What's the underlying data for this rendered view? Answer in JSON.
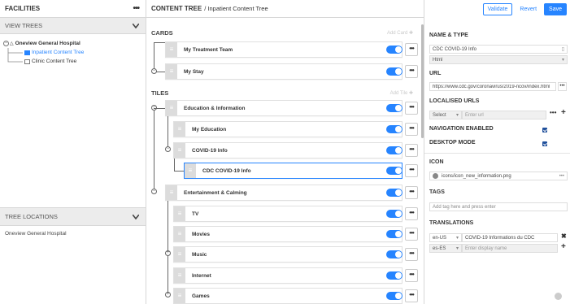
{
  "left": {
    "facilities_title": "FACILITIES",
    "view_trees": "VIEW TREES",
    "tree": [
      {
        "label": "Oneview General Hospital"
      },
      {
        "label": "Inpatient Content Tree"
      },
      {
        "label": "Clinic Content Tree"
      }
    ],
    "tree_locations": "TREE LOCATIONS",
    "locations": [
      "Oneview General Hospital"
    ]
  },
  "middle": {
    "title": "CONTENT TREE",
    "breadcrumb": "/ Inpatient Content Tree",
    "cards_label": "CARDS",
    "add_card": "Add Card",
    "cards": [
      "My Treatment Team",
      "My Stay"
    ],
    "tiles_label": "TILES",
    "add_tile": "Add Tile",
    "tiles": [
      "Education & Information",
      "My Education",
      "COVID-19 Info",
      "CDC COVID-19 Info",
      "Entertainment & Calming",
      "TV",
      "Movies",
      "Music",
      "Internet",
      "Games"
    ]
  },
  "right": {
    "validate": "Validate",
    "revert": "Revert",
    "save": "Save",
    "name_type": "NAME & TYPE",
    "name_value": "CDC COVID-19 Info",
    "type_value": "Html",
    "url_label": "URL",
    "url_value": "https://www.cdc.gov/coronavirus/2019-ncov/index.html",
    "localised_label": "LOCALISED URLS",
    "select_placeholder": "Select",
    "url_placeholder": "Enter url",
    "nav_enabled": "NAVIGATION ENABLED",
    "desktop_mode": "DESKTOP MODE",
    "icon_label": "ICON",
    "icon_value": "icons/icon_new_information.png",
    "tags_label": "TAGS",
    "tags_placeholder": "Add tag here and press enter",
    "translations_label": "TRANSLATIONS",
    "translations": [
      {
        "lang": "en-US",
        "value": "COVID-19 Informations du CDC"
      },
      {
        "lang": "es-ES",
        "value": "Enter display name"
      }
    ]
  },
  "colors": {
    "accent": "#2684ff",
    "check": "#1f4f9b"
  }
}
